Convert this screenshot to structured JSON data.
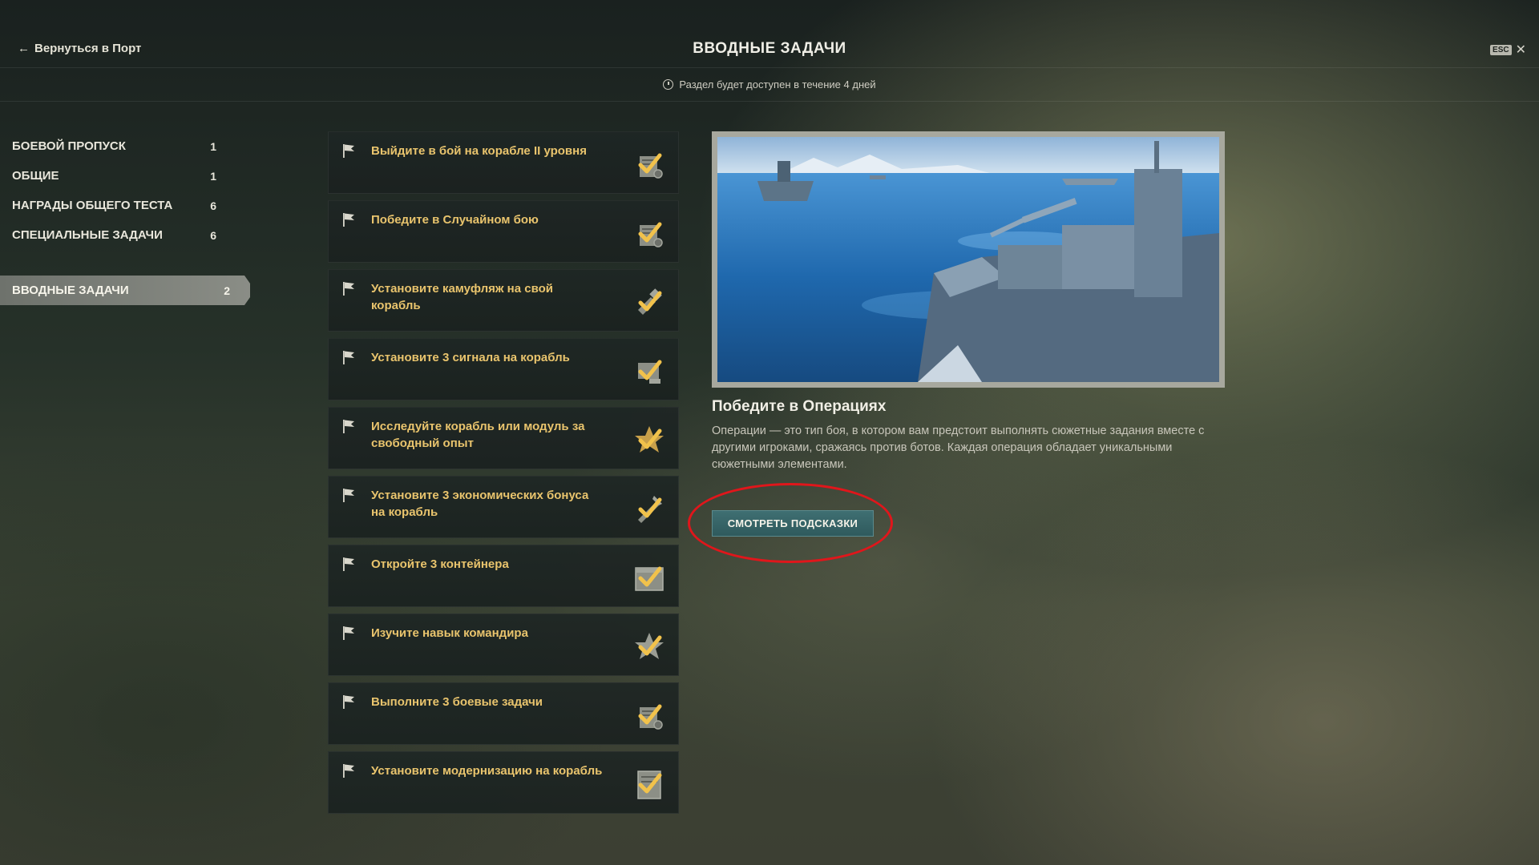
{
  "header": {
    "back_label": "Вернуться в Порт",
    "title": "ВВОДНЫЕ ЗАДАЧИ",
    "esc_label": "ESC"
  },
  "availability": {
    "text": "Раздел будет доступен в течение 4 дней"
  },
  "sidebar": {
    "items": [
      {
        "label": "БОЕВОЙ ПРОПУСК",
        "count": "1"
      },
      {
        "label": "ОБЩИЕ",
        "count": "1"
      },
      {
        "label": "НАГРАДЫ ОБЩЕГО ТЕСТА",
        "count": "6"
      },
      {
        "label": "СПЕЦИАЛЬНЫЕ ЗАДАЧИ",
        "count": "6"
      }
    ],
    "active": {
      "label": "ВВОДНЫЕ ЗАДАЧИ",
      "count": "2"
    }
  },
  "tasks": [
    {
      "label": "Выйдите в бой на корабле II уровня",
      "icon": "checklist-gear-icon"
    },
    {
      "label": "Победите в Случайном бою",
      "icon": "checklist-gear-icon"
    },
    {
      "label": "Установите камуфляж на свой корабль",
      "icon": "camouflage-check-icon"
    },
    {
      "label": "Установите 3 сигнала на корабль",
      "icon": "signal-flag-check-icon"
    },
    {
      "label": "Исследуйте корабль или модуль за свободный опыт",
      "icon": "star-check-icon"
    },
    {
      "label": "Установите 3 экономических бонуса на корабль",
      "icon": "bonus-check-icon"
    },
    {
      "label": "Откройте 3 контейнера",
      "icon": "container-check-icon"
    },
    {
      "label": "Изучите навык командира",
      "icon": "star-check-icon"
    },
    {
      "label": "Выполните 3 боевые задачи",
      "icon": "checklist-gear-icon"
    },
    {
      "label": "Установите модернизацию на корабль",
      "icon": "upgrade-check-icon"
    }
  ],
  "detail": {
    "title": "Победите в Операциях",
    "description": "Операции — это тип боя, в котором вам предстоит выполнять сюжетные задания вместе с другими игроками, сражаясь против ботов. Каждая операция обладает уникальными сюжетными элементами.",
    "button_label": "СМОТРЕТЬ ПОДСКАЗКИ"
  },
  "colors": {
    "task_text": "#e9c46d",
    "accent_button": "#3f6f72",
    "highlight": "#e0161b",
    "check_gold": "#f1c24b"
  }
}
